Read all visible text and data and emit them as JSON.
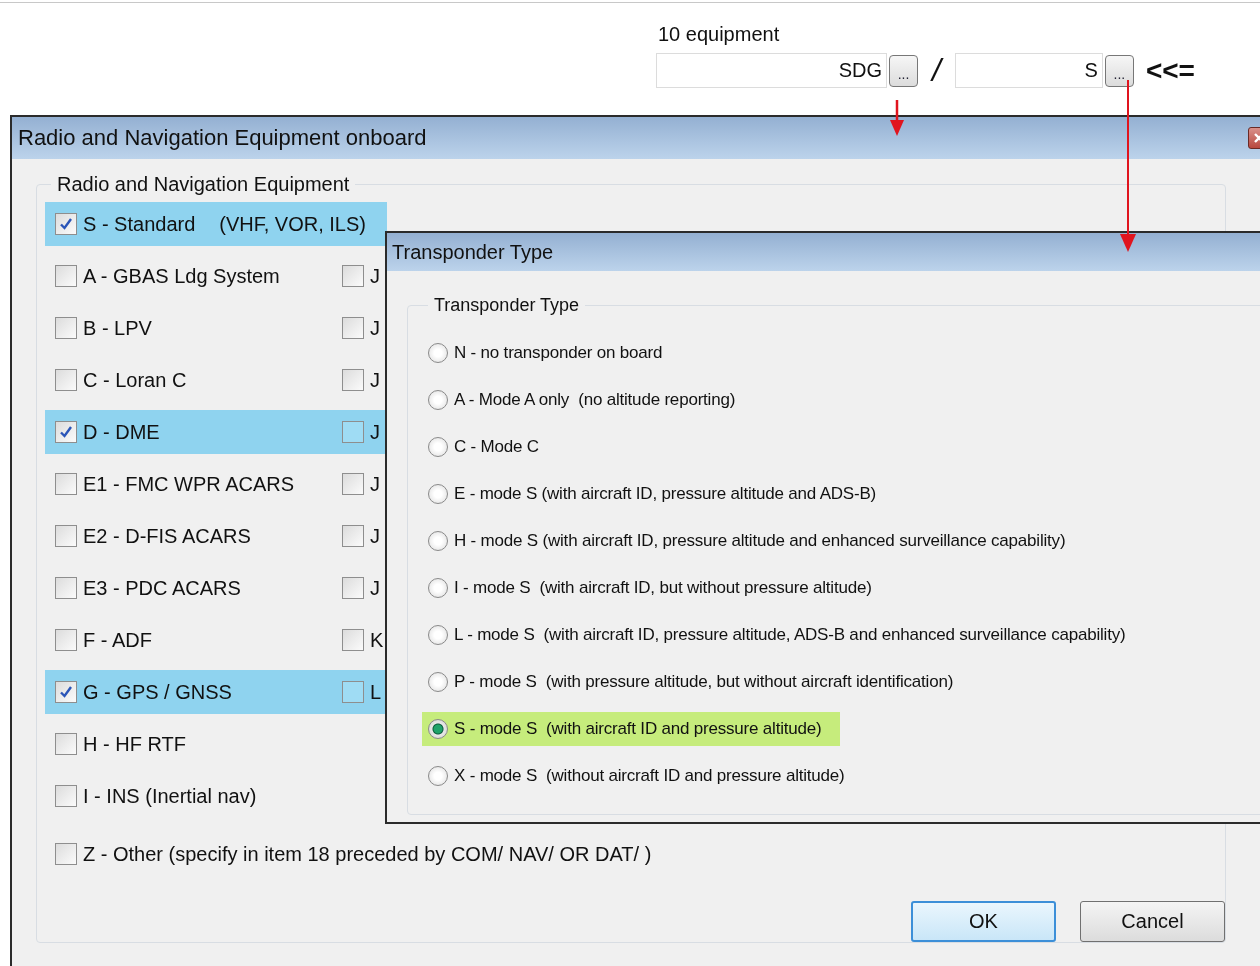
{
  "equipment_line": {
    "label": "10 equipment",
    "field_1": {
      "value": "SDG"
    },
    "browse_button_1": "...",
    "separator": "/",
    "field_2": {
      "value": "S"
    },
    "browse_button_2": "...",
    "pointer": "<<="
  },
  "main_dialog": {
    "title": "Radio and Navigation Equipment onboard",
    "group_label": "Radio and Navigation Equipment",
    "rows": [
      {
        "left": {
          "label": "S - Standard",
          "note": "(VHF, VOR, ILS)",
          "checked": true
        }
      },
      {
        "left": {
          "label": "A - GBAS Ldg System",
          "checked": false
        },
        "right": {
          "label": "J",
          "checked": false
        }
      },
      {
        "left": {
          "label": "B - LPV",
          "checked": false
        },
        "right": {
          "label": "J",
          "checked": false
        }
      },
      {
        "left": {
          "label": "C - Loran C",
          "checked": false
        },
        "right": {
          "label": "J",
          "checked": false
        }
      },
      {
        "left": {
          "label": "D - DME",
          "checked": true
        },
        "right": {
          "label": "J",
          "checked": false
        }
      },
      {
        "left": {
          "label": "E1 - FMC WPR ACARS",
          "checked": false
        },
        "right": {
          "label": "J",
          "checked": false
        }
      },
      {
        "left": {
          "label": "E2 - D-FIS ACARS",
          "checked": false
        },
        "right": {
          "label": "J",
          "checked": false
        }
      },
      {
        "left": {
          "label": "E3 - PDC ACARS",
          "checked": false
        },
        "right": {
          "label": "J",
          "checked": false
        }
      },
      {
        "left": {
          "label": "F - ADF",
          "checked": false
        },
        "right": {
          "label": "K",
          "checked": false
        }
      },
      {
        "left": {
          "label": "G - GPS / GNSS",
          "checked": true
        },
        "right": {
          "label": "L",
          "checked": false
        }
      },
      {
        "left": {
          "label": "H - HF RTF",
          "checked": false
        }
      },
      {
        "left": {
          "label": "I - INS (Inertial nav)",
          "checked": false
        }
      }
    ],
    "other": {
      "label": "Z - Other (specify in item 18 preceded by COM/ NAV/ OR DAT/ )",
      "checked": false
    },
    "buttons": [
      {
        "label": "OK",
        "focused": true
      },
      {
        "label": "Cancel",
        "focused": false
      }
    ]
  },
  "transponder_dialog": {
    "title": "Transponder Type",
    "group_label": "Transponder Type",
    "options": [
      {
        "label": "N - no transponder on board",
        "selected": false
      },
      {
        "label": "A - Mode A only  (no altitude reporting)",
        "selected": false
      },
      {
        "label": "C - Mode C",
        "selected": false
      },
      {
        "label": "E - mode S (with aircraft ID, pressure altitude and ADS-B)",
        "selected": false
      },
      {
        "label": "H - mode S (with aircraft ID, pressure altitude and enhanced surveillance capability)",
        "selected": false
      },
      {
        "label": "I - mode S  (with aircraft ID, but without pressure altitude)",
        "selected": false
      },
      {
        "label": "L - mode S  (with aircraft ID, pressure altitude, ADS-B and enhanced surveillance capability)",
        "selected": false
      },
      {
        "label": "P - mode S  (with pressure altitude, but without aircraft identification)",
        "selected": false
      },
      {
        "label": "S - mode S  (with aircraft ID and pressure altitude)",
        "selected": true
      },
      {
        "label": "X - mode S  (without aircraft ID and pressure altitude)",
        "selected": false
      }
    ]
  }
}
